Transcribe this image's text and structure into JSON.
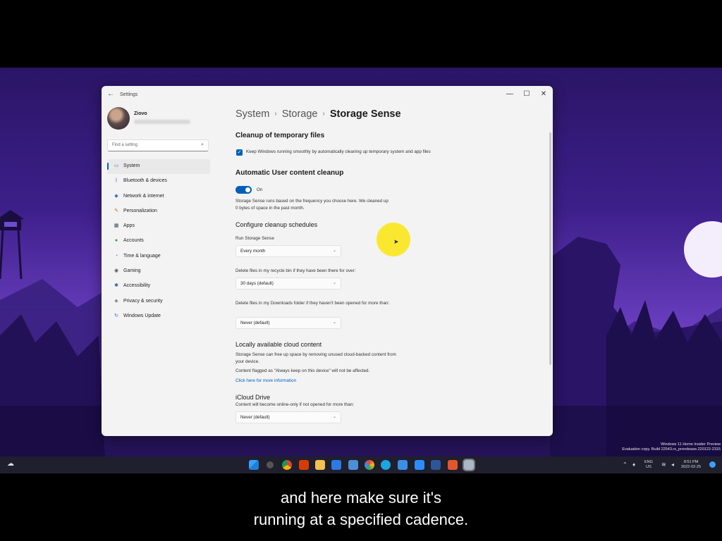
{
  "window": {
    "app_title": "Settings",
    "minimize_glyph": "—",
    "maximize_glyph": "☐",
    "close_glyph": "✕"
  },
  "profile": {
    "name": "Ziovo"
  },
  "search": {
    "placeholder": "Find a setting"
  },
  "sidebar": {
    "items": [
      {
        "label": "System",
        "icon": "monitor-icon",
        "active": true
      },
      {
        "label": "Bluetooth & devices",
        "icon": "bluetooth-icon"
      },
      {
        "label": "Network & internet",
        "icon": "wifi-icon"
      },
      {
        "label": "Personalization",
        "icon": "brush-icon"
      },
      {
        "label": "Apps",
        "icon": "apps-icon"
      },
      {
        "label": "Accounts",
        "icon": "person-icon"
      },
      {
        "label": "Time & language",
        "icon": "globe-clock-icon"
      },
      {
        "label": "Gaming",
        "icon": "gamepad-icon"
      },
      {
        "label": "Accessibility",
        "icon": "accessibility-icon"
      },
      {
        "label": "Privacy & security",
        "icon": "shield-icon"
      },
      {
        "label": "Windows Update",
        "icon": "update-icon"
      }
    ]
  },
  "breadcrumb": {
    "part1": "System",
    "part2": "Storage",
    "current": "Storage Sense"
  },
  "content": {
    "temp_files_title": "Cleanup of temporary files",
    "temp_files_checkbox": "Keep Windows running smoothly by automatically cleaning up temporary system and app files",
    "auto_cleanup_title": "Automatic User content cleanup",
    "toggle_state": "On",
    "auto_cleanup_desc": "Storage Sense runs based on the frequency you choose here. We cleaned up 0 bytes of space in the past month.",
    "schedules_title": "Configure cleanup schedules",
    "run_label": "Run Storage Sense",
    "run_value": "Every month",
    "recycle_label": "Delete files in my recycle bin if they have been there for over:",
    "recycle_value": "30 days (default)",
    "downloads_label": "Delete files in my Downloads folder if they haven't been opened for more than:",
    "downloads_value": "Never (default)",
    "cloud_title": "Locally available cloud content",
    "cloud_desc": "Storage Sense can free up space by removing unused cloud-backed content from your device.",
    "cloud_note": "Content flagged as \"Always keep on this device\" will not be affected.",
    "cloud_link": "Click here for more information",
    "icloud_title": "iCloud Drive",
    "icloud_desc": "Content will become online-only if not opened for more than:",
    "icloud_value": "Never (default)"
  },
  "watermark": {
    "line1": "Windows 11 Home Insider Preview",
    "line2": "Evaluation copy. Build 22543.rs_prerelease.220122-2315"
  },
  "tray": {
    "lang1": "ENG",
    "lang2": "US",
    "time": "8:51 PM",
    "date": "2022-02-25"
  },
  "caption": {
    "line1": "and here make sure it's",
    "line2": "running at a specified cadence."
  },
  "colors": {
    "accent": "#005fb8",
    "highlight": "#fae614",
    "wallpaper": "#4a2c9a"
  }
}
